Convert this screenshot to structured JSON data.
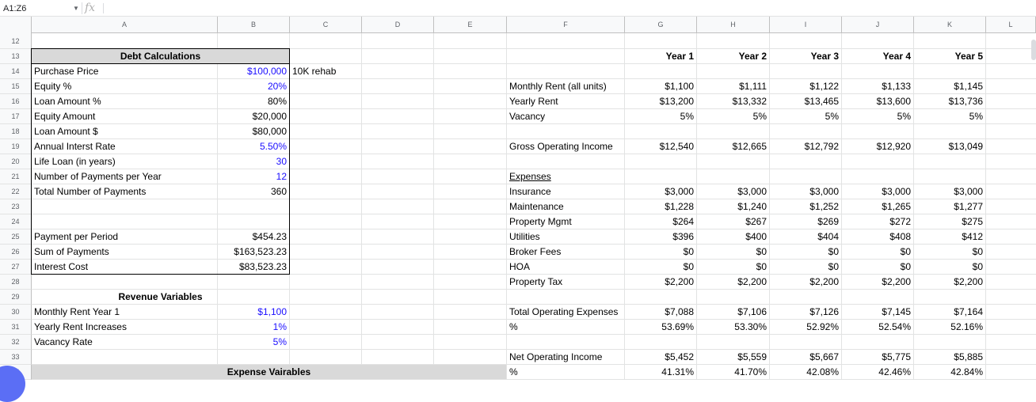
{
  "formula_bar": {
    "name_box": "A1:Z6",
    "fx": "fx",
    "formula": ""
  },
  "columns": [
    "A",
    "B",
    "C",
    "D",
    "E",
    "F",
    "G",
    "H",
    "I",
    "J",
    "K",
    "L"
  ],
  "rows": [
    "12",
    "13",
    "14",
    "15",
    "16",
    "17",
    "18",
    "19",
    "20",
    "21",
    "22",
    "23",
    "24",
    "25",
    "26",
    "27",
    "28",
    "29",
    "30",
    "31",
    "32",
    "33",
    "34"
  ],
  "debt": {
    "title": "Debt Calculations",
    "labels": [
      "Purchase Price",
      "Equity %",
      "Loan Amount %",
      "Equity Amount",
      "Loan Amount $",
      "Annual Interst Rate",
      "Life Loan (in years)",
      "Number of Payments per Year",
      "Total Number of Payments"
    ],
    "values": [
      "$100,000",
      "20%",
      "80%",
      "$20,000",
      "$80,000",
      "5.50%",
      "30",
      "12",
      "360"
    ],
    "note": "10K rehab",
    "payment_labels": [
      "Payment per Period",
      "Sum of Payments",
      "Interest Cost"
    ],
    "payment_values": [
      "$454.23",
      "$163,523.23",
      "$83,523.23"
    ]
  },
  "revenue": {
    "title": "Revenue Variables",
    "labels": [
      "Monthly Rent Year 1",
      "Yearly Rent Increases",
      "Vacancy Rate"
    ],
    "values": [
      "$1,100",
      "1%",
      "5%"
    ]
  },
  "expense_title": "Expense Vairables",
  "years": [
    "Year 1",
    "Year 2",
    "Year 3",
    "Year 4",
    "Year 5"
  ],
  "proforma": {
    "monthly_rent": {
      "label": "Monthly Rent (all units)",
      "values": [
        "$1,100",
        "$1,111",
        "$1,122",
        "$1,133",
        "$1,145"
      ]
    },
    "yearly_rent": {
      "label": "Yearly Rent",
      "values": [
        "$13,200",
        "$13,332",
        "$13,465",
        "$13,600",
        "$13,736"
      ]
    },
    "vacancy": {
      "label": "Vacancy",
      "values": [
        "5%",
        "5%",
        "5%",
        "5%",
        "5%"
      ]
    },
    "goi": {
      "label": "Gross Operating Income",
      "values": [
        "$12,540",
        "$12,665",
        "$12,792",
        "$12,920",
        "$13,049"
      ]
    },
    "expenses_header": "Expenses",
    "expenses": [
      {
        "label": "Insurance",
        "values": [
          "$3,000",
          "$3,000",
          "$3,000",
          "$3,000",
          "$3,000"
        ]
      },
      {
        "label": "Maintenance",
        "values": [
          "$1,228",
          "$1,240",
          "$1,252",
          "$1,265",
          "$1,277"
        ]
      },
      {
        "label": "Property Mgmt",
        "values": [
          "$264",
          "$267",
          "$269",
          "$272",
          "$275"
        ]
      },
      {
        "label": "Utilities",
        "values": [
          "$396",
          "$400",
          "$404",
          "$408",
          "$412"
        ]
      },
      {
        "label": "Broker Fees",
        "values": [
          "$0",
          "$0",
          "$0",
          "$0",
          "$0"
        ]
      },
      {
        "label": "HOA",
        "values": [
          "$0",
          "$0",
          "$0",
          "$0",
          "$0"
        ]
      },
      {
        "label": "Property Tax",
        "values": [
          "$2,200",
          "$2,200",
          "$2,200",
          "$2,200",
          "$2,200"
        ]
      }
    ],
    "toe": {
      "label": "Total Operating Expenses",
      "values": [
        "$7,088",
        "$7,106",
        "$7,126",
        "$7,145",
        "$7,164"
      ]
    },
    "toe_pct": {
      "label": "%",
      "values": [
        "53.69%",
        "53.30%",
        "52.92%",
        "52.54%",
        "52.16%"
      ]
    },
    "noi": {
      "label": "Net Operating Income",
      "values": [
        "$5,452",
        "$5,559",
        "$5,667",
        "$5,775",
        "$5,885"
      ]
    },
    "noi_pct": {
      "label": "%",
      "values": [
        "41.31%",
        "41.70%",
        "42.08%",
        "42.46%",
        "42.84%"
      ]
    }
  },
  "colors": {
    "input_blue": "#1a0dff",
    "header_gray": "#d9d9d9",
    "fab": "#5b6ef5"
  }
}
